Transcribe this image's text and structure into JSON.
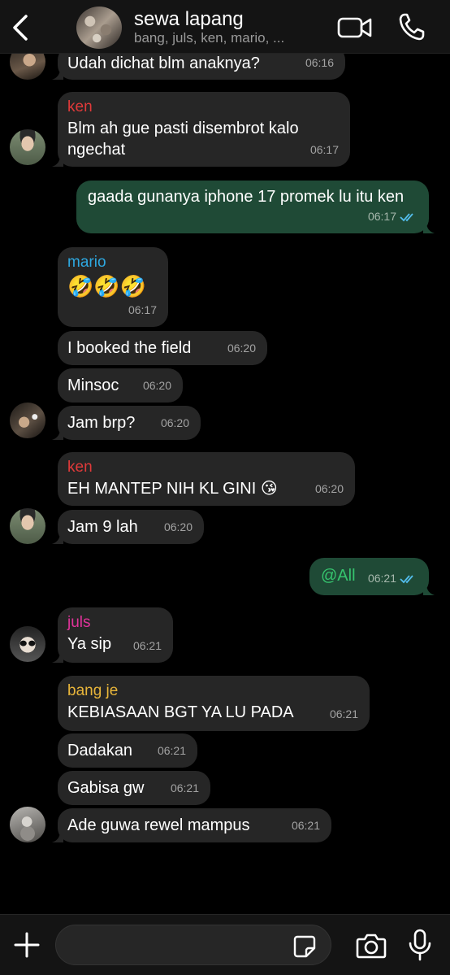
{
  "header": {
    "title": "sewa lapang",
    "subtitle": "bang, juls, ken, mario, ..."
  },
  "messages": [
    {
      "text": "Udah dichat blm anaknya?",
      "time": "06:16"
    },
    {
      "sender": "ken",
      "text": "Blm ah gue pasti disembrot kalo ngechat",
      "time": "06:17"
    },
    {
      "text": "gaada gunanya iphone 17 promek lu itu ken",
      "time": "06:17"
    },
    {
      "sender": "mario",
      "text": "🤣🤣🤣",
      "time": "06:17"
    },
    {
      "text": "I booked the field",
      "time": "06:20"
    },
    {
      "text": "Minsoc",
      "time": "06:20"
    },
    {
      "text": "Jam brp?",
      "time": "06:20"
    },
    {
      "sender": "ken",
      "text": "EH MANTEP NIH KL GINI 😘",
      "time": "06:20"
    },
    {
      "text": "Jam 9 lah",
      "time": "06:20"
    },
    {
      "text": "@All",
      "time": "06:21"
    },
    {
      "sender": "juls",
      "text": "Ya sip",
      "time": "06:21"
    },
    {
      "sender": "bang je",
      "text": "KEBIASAAN BGT YA LU PADA",
      "time": "06:21"
    },
    {
      "text": "Dadakan",
      "time": "06:21"
    },
    {
      "text": "Gabisa gw",
      "time": "06:21"
    },
    {
      "text": "Ade guwa rewel mampus",
      "time": "06:21"
    }
  ],
  "colors": {
    "ken": "#e03a3a",
    "mario": "#2ea8e0",
    "juls": "#e0339a",
    "bang_je": "#e8b53a",
    "mention": "#36c46e",
    "outgoing_bubble": "#1f4a36",
    "incoming_bubble": "#262626",
    "read_ticks": "#53bdeb"
  },
  "icons": [
    "back-chevron-icon",
    "video-call-icon",
    "phone-call-icon",
    "plus-icon",
    "sticker-icon",
    "camera-icon",
    "microphone-icon"
  ],
  "composer": {
    "value": "",
    "placeholder": ""
  }
}
